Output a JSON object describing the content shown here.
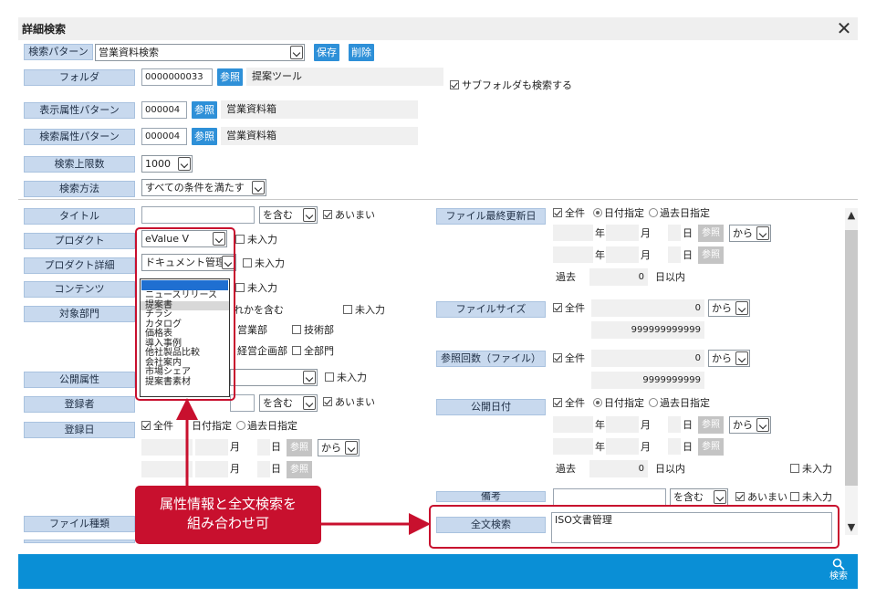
{
  "dialog": {
    "title": "詳細検索"
  },
  "top": {
    "pattern": {
      "label": "検索パターン",
      "value": "営業資料検索",
      "save": "保存",
      "delete": "削除"
    },
    "folder": {
      "label": "フォルダ",
      "value": "0000000033",
      "ref": "参照",
      "name": "提案ツール",
      "subfolder": "サブフォルダも検索する",
      "subfolder_checked": true
    },
    "display_attr": {
      "label": "表示属性パターン",
      "value": "000004",
      "ref": "参照",
      "name": "営業資料箱"
    },
    "search_attr": {
      "label": "検索属性パターン",
      "value": "000004",
      "ref": "参照",
      "name": "営業資料箱"
    },
    "limit": {
      "label": "検索上限数",
      "value": "1000"
    },
    "method": {
      "label": "検索方法",
      "value": "すべての条件を満たす"
    }
  },
  "left": {
    "title": {
      "label": "タイトル",
      "op": "を含む",
      "fuzzy": "あいまい"
    },
    "product": {
      "label": "プロダクト",
      "value": "eValue V",
      "empty": "未入力"
    },
    "product_detail": {
      "label": "プロダクト詳細",
      "value": "ドキュメント管理",
      "empty": "未入力"
    },
    "contents": {
      "label": "コンテンツ",
      "empty": "未入力"
    },
    "dept": {
      "label": "対象部門",
      "mode_tail": "れかを含む",
      "empty": "未入力",
      "d1": "営業部",
      "d2": "技術部",
      "d3": "経営企画部",
      "d4": "全部門"
    },
    "public_attr": {
      "label": "公開属性",
      "empty": "未入力"
    },
    "registrant": {
      "label": "登録者",
      "op": "を含む",
      "fuzzy": "あいまい"
    },
    "reg_date": {
      "label": "登録日",
      "all": "全件",
      "date_spec": "日付指定",
      "past_spec": "過去日指定",
      "month": "月",
      "day": "日",
      "ref": "参照",
      "from": "から"
    },
    "file_type": {
      "label": "ファイル種類"
    }
  },
  "listbox": {
    "options": [
      "ニュースリリース",
      "提案書",
      "チラシ",
      "カタログ",
      "価格表",
      "導入事例",
      "他社製品比較",
      "会社案内",
      "市場シェア",
      "提案書素材"
    ],
    "highlight_index": 1
  },
  "right": {
    "file_updated": {
      "label": "ファイル最終更新日",
      "all": "全件",
      "date_spec": "日付指定",
      "past_spec": "過去日指定",
      "year": "年",
      "month": "月",
      "day": "日",
      "ref": "参照",
      "from": "から",
      "past": "過去",
      "past_value": "0",
      "days_within": "日以内"
    },
    "file_size": {
      "label": "ファイルサイズ",
      "all": "全件",
      "min": "0",
      "max": "999999999999",
      "from": "から"
    },
    "ref_count": {
      "label": "参照回数（ファイル）",
      "all": "全件",
      "min": "0",
      "max": "9999999999",
      "from": "から"
    },
    "public_date": {
      "label": "公開日付",
      "all": "全件",
      "date_spec": "日付指定",
      "past_spec": "過去日指定",
      "year": "年",
      "month": "月",
      "day": "日",
      "ref": "参照",
      "from": "から",
      "past": "過去",
      "past_value": "0",
      "days_within": "日以内",
      "empty": "未入力"
    },
    "remarks": {
      "label": "備考",
      "op": "を含む",
      "fuzzy": "あいまい",
      "empty": "未入力"
    },
    "fulltext": {
      "label": "全文検索",
      "value": "ISO文書管理"
    }
  },
  "callout": {
    "line1": "属性情報と全文検索を",
    "line2": "組み合わせ可"
  },
  "footer": {
    "search": "検索"
  },
  "colors": {
    "accent": "#2e90d8",
    "footer": "#0a8fd6",
    "callout": "#c8102e",
    "label_bg": "#c8d9ee"
  }
}
